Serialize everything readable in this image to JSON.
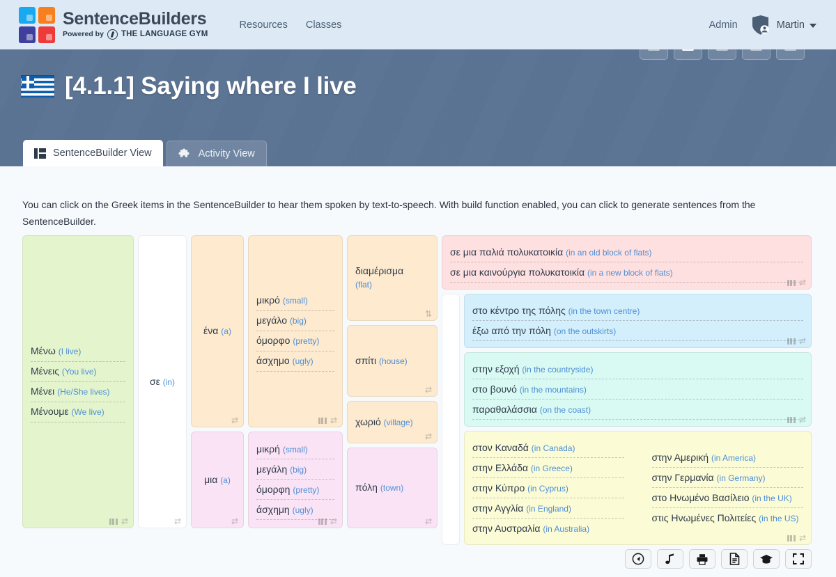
{
  "nav": {
    "brand_title": "SentenceBuilders",
    "powered_by": "Powered by",
    "gym_name": "THE LANGUAGE GYM",
    "links": [
      {
        "label": "Resources",
        "name": "nav-link-resources"
      },
      {
        "label": "Classes",
        "name": "nav-link-classes"
      }
    ],
    "admin_label": "Admin",
    "user_name": "Martin",
    "logo_colors": [
      "#18a9f0",
      "#f97f1e",
      "#3f3f9e",
      "#ef3a3a"
    ]
  },
  "hero": {
    "flag": "greek-flag",
    "title": "[4.1.1] Saying where I live",
    "tabs": [
      {
        "label": "SentenceBuilder View",
        "icon": "sentencebuilder-icon",
        "active": true
      },
      {
        "label": "Activity View",
        "icon": "puzzle-icon",
        "active": false
      }
    ]
  },
  "main": {
    "instructions": "You can click on the Greek items in the SentenceBuilder to hear them spoken by text-to-speech. With build function enabled, you can click to generate sentences from the SentenceBuilder."
  },
  "builder": {
    "col1": {
      "color": "green",
      "items": [
        {
          "gr": "Μένω",
          "en": "(I live)"
        },
        {
          "gr": "Μένεις",
          "en": "(You live)"
        },
        {
          "gr": "Μένει",
          "en": "(He/She lives)"
        },
        {
          "gr": "Μένουμε",
          "en": "(We live)"
        }
      ]
    },
    "col2": {
      "color": "white",
      "items": [
        {
          "gr": "σε",
          "en": "(in)"
        }
      ]
    },
    "col3": {
      "cells": [
        {
          "color": "orange",
          "gr": "ένα",
          "en": "(a)"
        },
        {
          "color": "pink",
          "gr": "μια",
          "en": "(a)"
        }
      ]
    },
    "col4": {
      "cells": [
        {
          "color": "orange",
          "items": [
            {
              "gr": "μικρό",
              "en": "(small)"
            },
            {
              "gr": "μεγάλο",
              "en": "(big)"
            },
            {
              "gr": "όμορφο",
              "en": "(pretty)"
            },
            {
              "gr": "άσχημο",
              "en": "(ugly)"
            }
          ]
        },
        {
          "color": "pink",
          "items": [
            {
              "gr": "μικρή",
              "en": "(small)"
            },
            {
              "gr": "μεγάλη",
              "en": "(big)"
            },
            {
              "gr": "όμορφη",
              "en": "(pretty)"
            },
            {
              "gr": "άσχημη",
              "en": "(ugly)"
            }
          ]
        }
      ]
    },
    "col5": {
      "cells": [
        {
          "color": "orange",
          "gr": "διαμέρισμα",
          "en": "(flat)",
          "handle": "updown"
        },
        {
          "color": "orange",
          "gr": "σπίτι",
          "en": "(house)",
          "handle": "swap"
        },
        {
          "color": "orange",
          "gr": "χωριό",
          "en": "(village)",
          "handle": "swap"
        },
        {
          "color": "pink",
          "gr": "πόλη",
          "en": "(town)",
          "handle": "swap"
        }
      ]
    },
    "right": {
      "rose_panel": {
        "color": "rose",
        "items": [
          {
            "gr": "σε μια παλιά πολυκατοικία",
            "en": "(in an old block of flats)"
          },
          {
            "gr": "σε μια καινούργια πολυκατοικία",
            "en": "(in a new block of flats)"
          }
        ]
      },
      "blue_panel": {
        "color": "blue",
        "items": [
          {
            "gr": "στο κέντρο της πόλης",
            "en": "(in the town centre)"
          },
          {
            "gr": "έξω από την πόλη",
            "en": "(on the outskirts)"
          }
        ]
      },
      "cyan_panel": {
        "color": "cyan",
        "items": [
          {
            "gr": "στην εξοχή",
            "en": "(in the countryside)"
          },
          {
            "gr": "στο βουνό",
            "en": "(in the mountains)"
          },
          {
            "gr": "παραθαλάσσια",
            "en": "(on the coast)"
          }
        ]
      },
      "yellow_panel": {
        "color": "yellow",
        "col_a": [
          {
            "gr": "στον Καναδά",
            "en": "(in Canada)"
          },
          {
            "gr": "στην Ελλάδα",
            "en": "(in Greece)"
          },
          {
            "gr": "στην Κύπρο",
            "en": "(in Cyprus)"
          },
          {
            "gr": "στην Αγγλία",
            "en": "(in England)"
          },
          {
            "gr": "στην Αυστραλία",
            "en": "(in Australia)"
          }
        ],
        "col_b": [
          {
            "gr": "στην Αμερική",
            "en": "(in America)"
          },
          {
            "gr": "στην Γερμανία",
            "en": "(in Germany)"
          },
          {
            "gr": "στο Ηνωμένο Βασίλειο",
            "en": "(in the UK)"
          },
          {
            "gr": "στις Ηνωμένες Πολιτείες",
            "en": "(in the US)"
          }
        ]
      }
    }
  },
  "bottom_toolbar": [
    {
      "icon": "gauge-icon",
      "name": "speed-button"
    },
    {
      "icon": "music-note-icon",
      "name": "audio-button"
    },
    {
      "icon": "printer-icon",
      "name": "print-button"
    },
    {
      "icon": "document-icon",
      "name": "worksheet-button"
    },
    {
      "icon": "graduation-cap-icon",
      "name": "learn-button"
    },
    {
      "icon": "fullscreen-icon",
      "name": "fullscreen-button"
    }
  ],
  "colors": {
    "nav_bg": "#ddeaf6",
    "hero_bg": "#587191",
    "page_bg": "#f7fafd",
    "english_text": "#4d8fd6",
    "greek_text": "#2f3b4a"
  }
}
